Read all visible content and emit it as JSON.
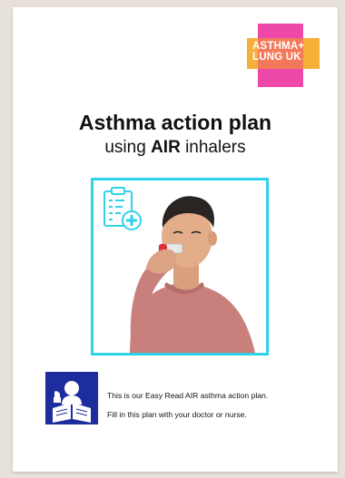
{
  "logo": {
    "line1": "ASTHMA+",
    "line2": "LUNG UK",
    "colors": {
      "pink": "#ee3ea6",
      "orange": "#f5a623"
    }
  },
  "cover": {
    "title": "Asthma action plan",
    "subtitle_prefix": "using ",
    "subtitle_bold": "AIR",
    "subtitle_suffix": " inhalers"
  },
  "photo": {
    "icon": "clipboard-plus-icon",
    "subject": "man-using-inhaler",
    "border_color": "#2ed3ea"
  },
  "easy_read": {
    "icon": "easy-read-icon",
    "line1": "This is our Easy Read AIR asthma action plan.",
    "line2": "Fill in this plan with your doctor or nurse."
  }
}
